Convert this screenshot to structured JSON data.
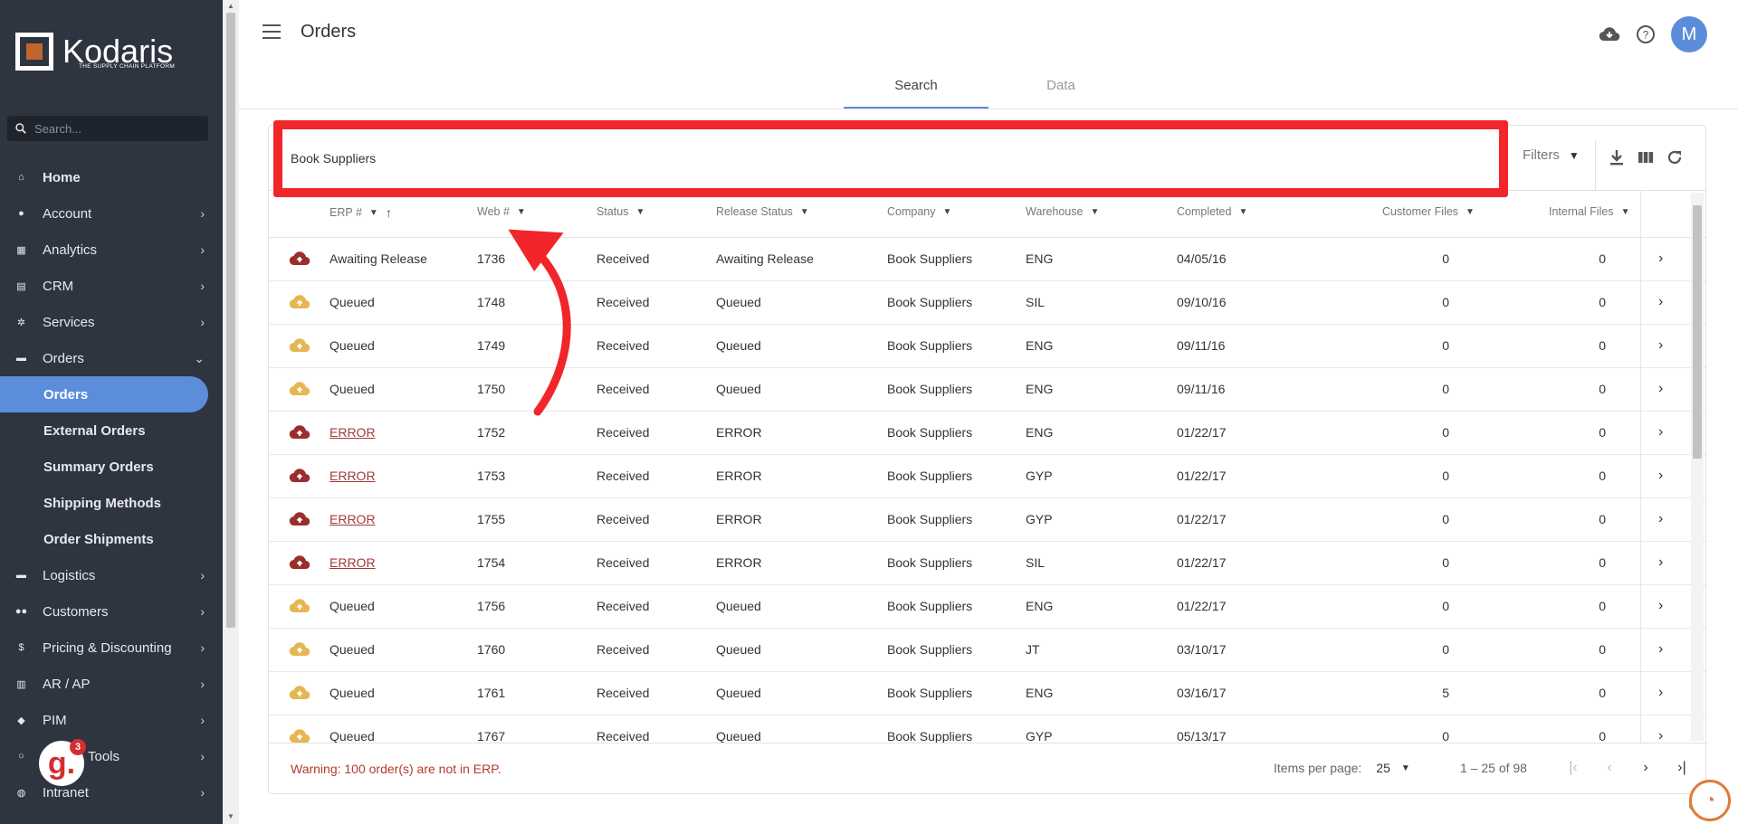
{
  "sidebar": {
    "logo_text": "Kodaris",
    "logo_sub": "THE SUPPLY CHAIN PLATFORM",
    "search_placeholder": "Search...",
    "items": [
      {
        "label": "Home"
      },
      {
        "label": "Account"
      },
      {
        "label": "Analytics"
      },
      {
        "label": "CRM"
      },
      {
        "label": "Services"
      },
      {
        "label": "Orders"
      },
      {
        "label": "Orders"
      },
      {
        "label": "External Orders"
      },
      {
        "label": "Summary Orders"
      },
      {
        "label": "Shipping Methods"
      },
      {
        "label": "Order Shipments"
      },
      {
        "label": "Logistics"
      },
      {
        "label": "Customers"
      },
      {
        "label": "Pricing & Discounting"
      },
      {
        "label": "AR / AP"
      },
      {
        "label": "PIM"
      },
      {
        "label": "Tools"
      },
      {
        "label": "Intranet"
      }
    ],
    "notification_count": "3"
  },
  "header": {
    "title": "Orders",
    "avatar_initial": "M"
  },
  "tabs": [
    {
      "label": "Search"
    },
    {
      "label": "Data"
    }
  ],
  "search": {
    "value": "Book Suppliers",
    "filters_label": "Filters"
  },
  "table": {
    "columns": [
      "ERP #",
      "Web #",
      "Status",
      "Release Status",
      "Company",
      "Warehouse",
      "Completed",
      "Customer Files",
      "Internal Files"
    ],
    "rows": [
      {
        "cloud": "red",
        "erp": "Awaiting Release",
        "erp_error": false,
        "web": "1736",
        "status": "Received",
        "release": "Awaiting Release",
        "company": "Book Suppliers",
        "warehouse": "ENG",
        "completed": "04/05/16",
        "cust": "0",
        "internal": "0"
      },
      {
        "cloud": "yellow",
        "erp": "Queued",
        "erp_error": false,
        "web": "1748",
        "status": "Received",
        "release": "Queued",
        "company": "Book Suppliers",
        "warehouse": "SIL",
        "completed": "09/10/16",
        "cust": "0",
        "internal": "0"
      },
      {
        "cloud": "yellow",
        "erp": "Queued",
        "erp_error": false,
        "web": "1749",
        "status": "Received",
        "release": "Queued",
        "company": "Book Suppliers",
        "warehouse": "ENG",
        "completed": "09/11/16",
        "cust": "0",
        "internal": "0"
      },
      {
        "cloud": "yellow",
        "erp": "Queued",
        "erp_error": false,
        "web": "1750",
        "status": "Received",
        "release": "Queued",
        "company": "Book Suppliers",
        "warehouse": "ENG",
        "completed": "09/11/16",
        "cust": "0",
        "internal": "0"
      },
      {
        "cloud": "red",
        "erp": "ERROR",
        "erp_error": true,
        "web": "1752",
        "status": "Received",
        "release": "ERROR",
        "company": "Book Suppliers",
        "warehouse": "ENG",
        "completed": "01/22/17",
        "cust": "0",
        "internal": "0"
      },
      {
        "cloud": "red",
        "erp": "ERROR",
        "erp_error": true,
        "web": "1753",
        "status": "Received",
        "release": "ERROR",
        "company": "Book Suppliers",
        "warehouse": "GYP",
        "completed": "01/22/17",
        "cust": "0",
        "internal": "0"
      },
      {
        "cloud": "red",
        "erp": "ERROR",
        "erp_error": true,
        "web": "1755",
        "status": "Received",
        "release": "ERROR",
        "company": "Book Suppliers",
        "warehouse": "GYP",
        "completed": "01/22/17",
        "cust": "0",
        "internal": "0"
      },
      {
        "cloud": "red",
        "erp": "ERROR",
        "erp_error": true,
        "web": "1754",
        "status": "Received",
        "release": "ERROR",
        "company": "Book Suppliers",
        "warehouse": "SIL",
        "completed": "01/22/17",
        "cust": "0",
        "internal": "0"
      },
      {
        "cloud": "yellow",
        "erp": "Queued",
        "erp_error": false,
        "web": "1756",
        "status": "Received",
        "release": "Queued",
        "company": "Book Suppliers",
        "warehouse": "ENG",
        "completed": "01/22/17",
        "cust": "0",
        "internal": "0"
      },
      {
        "cloud": "yellow",
        "erp": "Queued",
        "erp_error": false,
        "web": "1760",
        "status": "Received",
        "release": "Queued",
        "company": "Book Suppliers",
        "warehouse": "JT",
        "completed": "03/10/17",
        "cust": "0",
        "internal": "0"
      },
      {
        "cloud": "yellow",
        "erp": "Queued",
        "erp_error": false,
        "web": "1761",
        "status": "Received",
        "release": "Queued",
        "company": "Book Suppliers",
        "warehouse": "ENG",
        "completed": "03/16/17",
        "cust": "5",
        "internal": "0"
      },
      {
        "cloud": "yellow",
        "erp": "Queued",
        "erp_error": false,
        "web": "1767",
        "status": "Received",
        "release": "Queued",
        "company": "Book Suppliers",
        "warehouse": "GYP",
        "completed": "05/13/17",
        "cust": "0",
        "internal": "0"
      }
    ]
  },
  "footer": {
    "warning": "Warning: 100 order(s) are not in ERP.",
    "items_per_page_label": "Items per page:",
    "items_per_page": "25",
    "range": "1 – 25 of 98"
  },
  "colors": {
    "sidebar_bg": "#2e3440",
    "accent": "#5b8ddb",
    "highlight_red": "#f0262a",
    "error_text": "#a23a3a",
    "cloud_red": "#9b2d2d",
    "cloud_yellow": "#e6b650"
  },
  "icons": {
    "menu": "hamburger-icon",
    "cloud_download": "cloud-download-icon",
    "help": "help-icon",
    "download": "download-icon",
    "columns": "columns-icon",
    "refresh": "refresh-icon",
    "cloud_upload": "cloud-upload-icon"
  }
}
